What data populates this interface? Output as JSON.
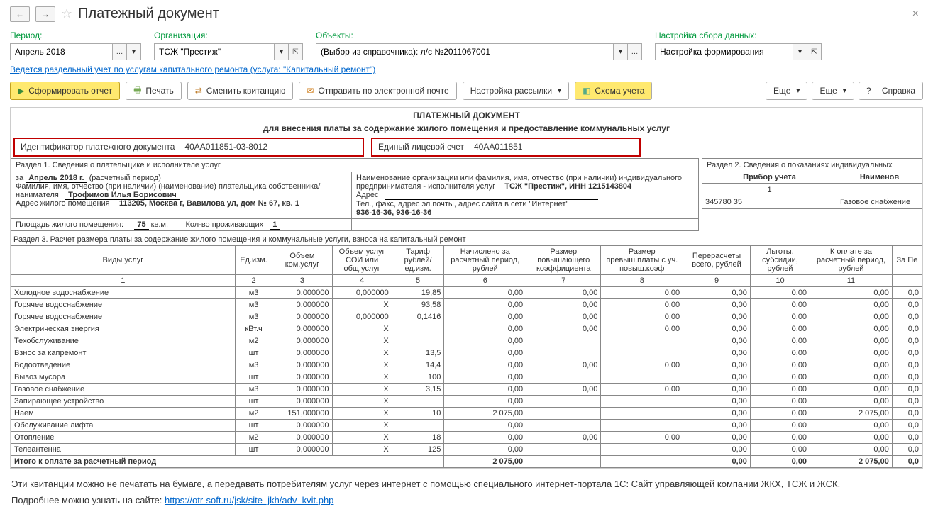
{
  "title": "Платежный документ",
  "filters": {
    "period_label": "Период:",
    "period_value": "Апрель 2018",
    "org_label": "Организация:",
    "org_value": "ТСЖ \"Престиж\"",
    "objects_label": "Объекты:",
    "objects_value": "(Выбор из справочника): л/с №2011067001",
    "settings_label": "Настройка сбора данных:",
    "settings_value": "Настройка формирования"
  },
  "caprepair_link": "Ведется раздельный учет по услугам капитального ремонта (услуга: \"Капитальный ремонт\")",
  "toolbar": {
    "form": "Сформировать отчет",
    "print": "Печать",
    "change": "Сменить квитанцию",
    "send": "Отправить по электронной почте",
    "mailing": "Настройка рассылки",
    "scheme": "Схема учета",
    "more": "Еще",
    "help": "Справка"
  },
  "doc": {
    "header": "ПЛАТЕЖНЫЙ ДОКУМЕНТ",
    "sub": "для внесения платы за содержание жилого помещения и предоставление коммунальных услуг",
    "id_label": "Идентификатор платежного документа",
    "id_value": "40АА011851-03-8012",
    "acc_label": "Единый лицевой счет",
    "acc_value": "40АА011851"
  },
  "section1": {
    "title": "Раздел 1.    Сведения о плательщике и исполнителе услуг",
    "za": "за",
    "period": "Апрель 2018 г.",
    "period_note": "(расчетный период)",
    "fio_label": "Фамилия, имя, отчество (при наличии) (наименование) плательщика собственника/нанимателя",
    "fio_value": "Трофимов Илья Борисович",
    "addr_label": "Адрес жилого помещения",
    "addr_value": "113205, Москва г, Вавилова ул, дом № 67, кв. 1",
    "area_label": "Площадь жилого помещения:",
    "area_value": "75",
    "area_unit": "кв.м.",
    "residents_label": "Кол-во проживающих",
    "residents_value": "1",
    "org_label": "Наименование организации или фамилия, имя, отчество (при наличии) индивидуального предпринимателя - исполнителя услуг",
    "org_value": "ТСЖ \"Престиж\", ИНН 1215143804",
    "org_addr_label": "Адрес",
    "contacts_label": "Тел., факс, адрес эл.почты, адрес сайта в сети \"Интернет\"",
    "contacts_value": "936-16-36, 936-16-36"
  },
  "section2": {
    "title": "Раздел 2.     Сведения о показаниях индивидуальных",
    "h1": "Прибор учета",
    "h2": "Наименов",
    "n1": "1",
    "row_id": "345780 35",
    "row_name": "Газовое снабжение"
  },
  "section3": {
    "title": "Раздел 3.    Расчет размера платы за содержание жилого помещения и коммунальные услуги, взноса на капитальный ремонт",
    "headers": [
      "Виды услуг",
      "Ед.изм.",
      "Объем ком.услуг",
      "Объем услуг СОИ или общ.услуг",
      "Тариф рублей/ ед.изм.",
      "Начислено за расчетный период, рублей",
      "Размер повышающего коэффициента",
      "Размер превыш.платы с уч. повыш.коэф",
      "Перерасчеты всего, рублей",
      "Льготы, субсидии, рублей",
      "К оплате за расчетный период, рублей",
      "За Пе"
    ],
    "idx": [
      "1",
      "2",
      "3",
      "4",
      "5",
      "6",
      "7",
      "8",
      "9",
      "10",
      "11",
      ""
    ],
    "rows": [
      {
        "name": "Холодное водоснабжение",
        "unit": "м3",
        "v": "0,000000",
        "soi": "0,000000",
        "tariff": "19,85",
        "accr": "0,00",
        "kcf": "0,00",
        "exc": "0,00",
        "rec": "0,00",
        "ben": "0,00",
        "pay": "0,00",
        "last": "0,0"
      },
      {
        "name": "Горячее водоснабжение",
        "unit": "м3",
        "v": "0,000000",
        "soi": "Х",
        "tariff": "93,58",
        "accr": "0,00",
        "kcf": "0,00",
        "exc": "0,00",
        "rec": "0,00",
        "ben": "0,00",
        "pay": "0,00",
        "last": "0,0"
      },
      {
        "name": "Горячее водоснабжение",
        "unit": "м3",
        "v": "0,000000",
        "soi": "0,000000",
        "tariff": "0,1416",
        "accr": "0,00",
        "kcf": "0,00",
        "exc": "0,00",
        "rec": "0,00",
        "ben": "0,00",
        "pay": "0,00",
        "last": "0,0"
      },
      {
        "name": "Электрическая энергия",
        "unit": "кВт.ч",
        "v": "0,000000",
        "soi": "Х",
        "tariff": "",
        "accr": "0,00",
        "kcf": "0,00",
        "exc": "0,00",
        "rec": "0,00",
        "ben": "0,00",
        "pay": "0,00",
        "last": "0,0"
      },
      {
        "name": "Техобслуживание",
        "unit": "м2",
        "v": "0,000000",
        "soi": "Х",
        "tariff": "",
        "accr": "0,00",
        "kcf": "",
        "exc": "",
        "rec": "0,00",
        "ben": "0,00",
        "pay": "0,00",
        "last": "0,0"
      },
      {
        "name": "Взнос за капремонт",
        "unit": "шт",
        "v": "0,000000",
        "soi": "Х",
        "tariff": "13,5",
        "accr": "0,00",
        "kcf": "",
        "exc": "",
        "rec": "0,00",
        "ben": "0,00",
        "pay": "0,00",
        "last": "0,0"
      },
      {
        "name": "Водоотведение",
        "unit": "м3",
        "v": "0,000000",
        "soi": "Х",
        "tariff": "14,4",
        "accr": "0,00",
        "kcf": "0,00",
        "exc": "0,00",
        "rec": "0,00",
        "ben": "0,00",
        "pay": "0,00",
        "last": "0,0"
      },
      {
        "name": "Вывоз мусора",
        "unit": "шт",
        "v": "0,000000",
        "soi": "Х",
        "tariff": "100",
        "accr": "0,00",
        "kcf": "",
        "exc": "",
        "rec": "0,00",
        "ben": "0,00",
        "pay": "0,00",
        "last": "0,0"
      },
      {
        "name": "Газовое снабжение",
        "unit": "м3",
        "v": "0,000000",
        "soi": "Х",
        "tariff": "3,15",
        "accr": "0,00",
        "kcf": "0,00",
        "exc": "0,00",
        "rec": "0,00",
        "ben": "0,00",
        "pay": "0,00",
        "last": "0,0"
      },
      {
        "name": "Запирающее устройство",
        "unit": "шт",
        "v": "0,000000",
        "soi": "Х",
        "tariff": "",
        "accr": "0,00",
        "kcf": "",
        "exc": "",
        "rec": "0,00",
        "ben": "0,00",
        "pay": "0,00",
        "last": "0,0"
      },
      {
        "name": "Наем",
        "unit": "м2",
        "v": "151,000000",
        "soi": "Х",
        "tariff": "10",
        "accr": "2 075,00",
        "kcf": "",
        "exc": "",
        "rec": "0,00",
        "ben": "0,00",
        "pay": "2 075,00",
        "last": "0,0"
      },
      {
        "name": "Обслуживание лифта",
        "unit": "шт",
        "v": "0,000000",
        "soi": "Х",
        "tariff": "",
        "accr": "0,00",
        "kcf": "",
        "exc": "",
        "rec": "0,00",
        "ben": "0,00",
        "pay": "0,00",
        "last": "0,0"
      },
      {
        "name": "Отопление",
        "unit": "м2",
        "v": "0,000000",
        "soi": "Х",
        "tariff": "18",
        "accr": "0,00",
        "kcf": "0,00",
        "exc": "0,00",
        "rec": "0,00",
        "ben": "0,00",
        "pay": "0,00",
        "last": "0,0"
      },
      {
        "name": "Телеантенна",
        "unit": "шт",
        "v": "0,000000",
        "soi": "Х",
        "tariff": "125",
        "accr": "0,00",
        "kcf": "",
        "exc": "",
        "rec": "0,00",
        "ben": "0,00",
        "pay": "0,00",
        "last": "0,0"
      }
    ],
    "total_label": "Итого к оплате за расчетный период",
    "total_accr": "2 075,00",
    "total_rec": "0,00",
    "total_ben": "0,00",
    "total_pay": "2 075,00",
    "total_last": "0,0"
  },
  "footer": {
    "text": "Эти квитанции можно не печатать на бумаге, а передавать потребителям услуг через интернет с помощью специального интернет-портала 1С: Сайт управляющей компании ЖКХ, ТСЖ и ЖСК.",
    "link_prefix": "Подробнее можно узнать на сайте: ",
    "link_url": "https://otr-soft.ru/jsk/site_jkh/adv_kvit.php"
  }
}
